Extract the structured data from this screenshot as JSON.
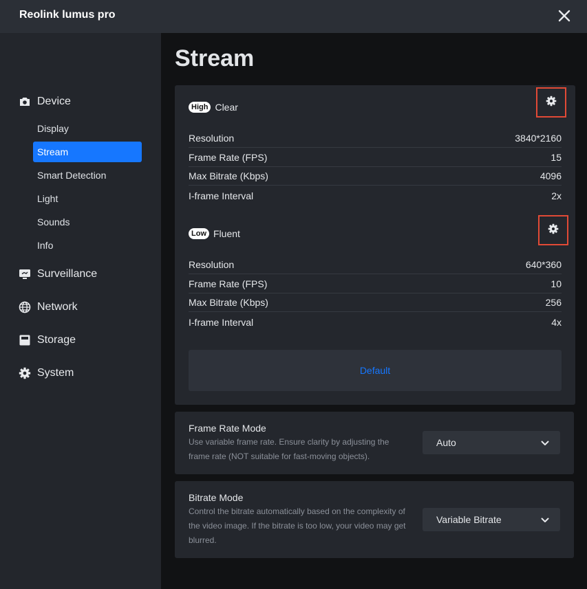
{
  "window": {
    "title": "Reolink lumus pro"
  },
  "sidebar": {
    "groups": [
      {
        "label": "Device",
        "icon": "camera-icon"
      },
      {
        "label": "Surveillance",
        "icon": "monitor-icon"
      },
      {
        "label": "Network",
        "icon": "globe-icon"
      },
      {
        "label": "Storage",
        "icon": "storage-icon"
      },
      {
        "label": "System",
        "icon": "gear-icon"
      }
    ],
    "device_items": [
      {
        "label": "Display"
      },
      {
        "label": "Stream",
        "active": true
      },
      {
        "label": "Smart Detection"
      },
      {
        "label": "Light"
      },
      {
        "label": "Sounds"
      },
      {
        "label": "Info"
      }
    ]
  },
  "page": {
    "title": "Stream"
  },
  "stream": {
    "high": {
      "badge": "High",
      "name": "Clear",
      "rows": [
        {
          "label": "Resolution",
          "value": "3840*2160"
        },
        {
          "label": "Frame Rate (FPS)",
          "value": "15"
        },
        {
          "label": "Max Bitrate (Kbps)",
          "value": "4096"
        },
        {
          "label": "I-frame Interval",
          "value": "2x"
        }
      ]
    },
    "low": {
      "badge": "Low",
      "name": "Fluent",
      "rows": [
        {
          "label": "Resolution",
          "value": "640*360"
        },
        {
          "label": "Frame Rate (FPS)",
          "value": "10"
        },
        {
          "label": "Max Bitrate (Kbps)",
          "value": "256"
        },
        {
          "label": "I-frame Interval",
          "value": "4x"
        }
      ]
    },
    "default_label": "Default"
  },
  "frame_rate_mode": {
    "title": "Frame Rate Mode",
    "description": "Use variable frame rate. Ensure clarity by adjusting the frame rate (NOT suitable for fast-moving objects).",
    "selected": "Auto"
  },
  "bitrate_mode": {
    "title": "Bitrate Mode",
    "description": "Control the bitrate automatically based on the complexity of the video image. If the bitrate is too low, your video may get blurred.",
    "selected": "Variable Bitrate"
  },
  "colors": {
    "accent": "#1677ff",
    "highlight": "#e24a36",
    "background": "#111214",
    "sidebar": "#23262c",
    "card": "#24272d"
  }
}
